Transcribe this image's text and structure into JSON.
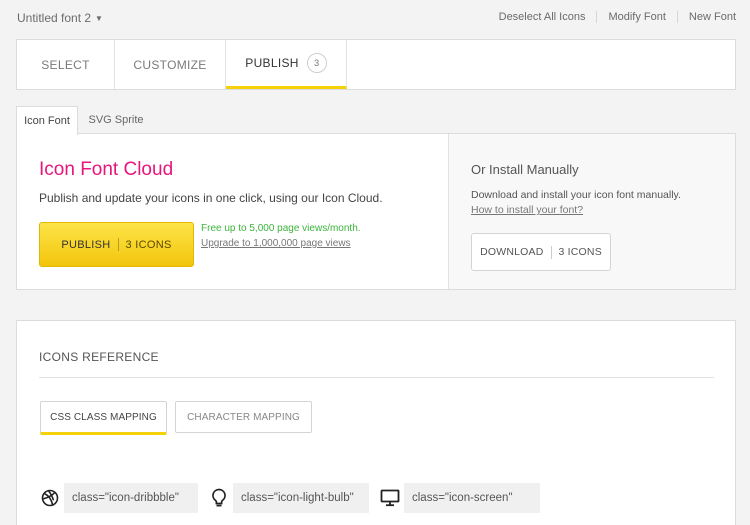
{
  "header": {
    "font_name": "Untitled font 2",
    "links": [
      "Deselect All Icons",
      "Modify Font",
      "New Font"
    ]
  },
  "steps": {
    "select": "SELECT",
    "customize": "CUSTOMIZE",
    "publish": "PUBLISH",
    "publish_count": "3"
  },
  "subtabs": {
    "icon_font": "Icon Font",
    "svg_sprite": "SVG Sprite"
  },
  "cloud": {
    "title": "Icon Font Cloud",
    "description": "Publish and update your icons in one click, using our Icon Cloud.",
    "publish_label": "PUBLISH",
    "publish_count": "3 ICONS",
    "free_text": "Free up to 5,000 page views/month.",
    "upgrade_link": "Upgrade to 1,000,000 page views"
  },
  "manual": {
    "title": "Or Install Manually",
    "description": "Download and install your icon font manually.",
    "how_link": "How to install your font?",
    "download_label": "DOWNLOAD",
    "download_count": "3 ICONS"
  },
  "reference": {
    "title": "ICONS REFERENCE",
    "css_mapping": "CSS CLASS MAPPING",
    "char_mapping": "CHARACTER MAPPING",
    "items": [
      {
        "icon": "dribbble-icon",
        "class_text": "class=\"icon-dribbble\""
      },
      {
        "icon": "light-bulb-icon",
        "class_text": "class=\"icon-light-bulb\""
      },
      {
        "icon": "screen-icon",
        "class_text": "class=\"icon-screen\""
      }
    ]
  },
  "colors": {
    "accent_yellow": "#f5d10a",
    "title_pink": "#e8157b",
    "free_green": "#3cb53c"
  }
}
